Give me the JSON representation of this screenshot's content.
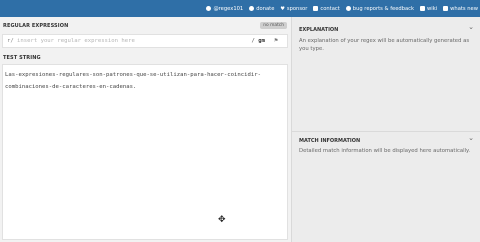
{
  "topbar": {
    "links": [
      {
        "icon": "twitter-icon",
        "label": "@regex101"
      },
      {
        "icon": "dollar-icon",
        "label": "donate"
      },
      {
        "icon": "heart-icon",
        "label": "sponsor"
      },
      {
        "icon": "mail-icon",
        "label": "contact"
      },
      {
        "icon": "bug-icon",
        "label": "bug reports & feedback"
      },
      {
        "icon": "wiki-icon",
        "label": "wiki"
      },
      {
        "icon": "news-icon",
        "label": "whats new"
      }
    ],
    "colors": {
      "background": "#2f6fa7",
      "text": "#ffffff"
    }
  },
  "regex": {
    "section_label": "REGULAR EXPRESSION",
    "status_badge": "no match",
    "delimiter_open": "r/",
    "placeholder": "insert your regular expression here",
    "delimiter_close": "/",
    "flags": "gm"
  },
  "test_string": {
    "section_label": "TEST STRING",
    "line1": "Las-expresiones-regulares-son-patrones-que-se-utilizan-para-hacer-coincidir-",
    "line2": "combinaciones-de-caracteres-en-cadenas."
  },
  "explanation": {
    "title": "EXPLANATION",
    "text": "An explanation of your regex will be automatically generated as you type."
  },
  "match_information": {
    "title": "MATCH INFORMATION",
    "text": "Detailed match information will be displayed here automatically."
  }
}
